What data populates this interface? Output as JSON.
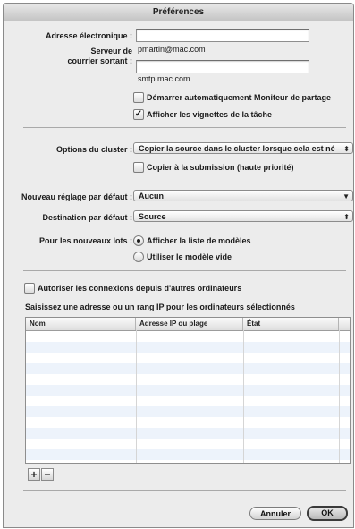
{
  "window": {
    "title": "Préférences"
  },
  "account": {
    "email_label": "Adresse électronique :",
    "email_value": "",
    "smtp_label_line1": "Serveur de",
    "smtp_label_line2": "courrier sortant :",
    "email_display": "pmartin@mac.com",
    "smtp_value": "",
    "smtp_display": "smtp.mac.com"
  },
  "checkboxes": {
    "auto_start": {
      "label": "Démarrer automatiquement Moniteur de partage",
      "checked": false
    },
    "task_thumbnails": {
      "label": "Afficher les vignettes de la tâche",
      "checked": true
    },
    "submit_copy": {
      "label": "Copier à la submission (haute priorité)",
      "checked": false
    },
    "allow_connections": {
      "label": "Autoriser les connexions depuis d'autres ordinateurs",
      "checked": false
    }
  },
  "cluster": {
    "label": "Options du cluster :",
    "selected": "Copier la source dans le cluster lorsque cela est né"
  },
  "defaults": {
    "preset_label": "Nouveau réglage par défaut :",
    "preset_value": "Aucun",
    "destination_label": "Destination par défaut :",
    "destination_value": "Source"
  },
  "new_batches": {
    "label": "Pour les nouveaux lots :",
    "option_templates": "Afficher la liste de modèles",
    "option_blank": "Utiliser le modèle vide",
    "selected": "option_templates"
  },
  "ip_table": {
    "caption": "Saisissez une adresse ou un rang IP pour les ordinateurs sélectionnés",
    "columns": [
      "Nom",
      "Adresse IP ou plage",
      "État"
    ],
    "rows": []
  },
  "table_buttons": {
    "add": "+",
    "remove": "−"
  },
  "footer": {
    "cancel": "Annuler",
    "ok": "OK"
  },
  "icons": {
    "check": "✓",
    "popup_arrows": "⬍",
    "popup_down": "▼"
  }
}
